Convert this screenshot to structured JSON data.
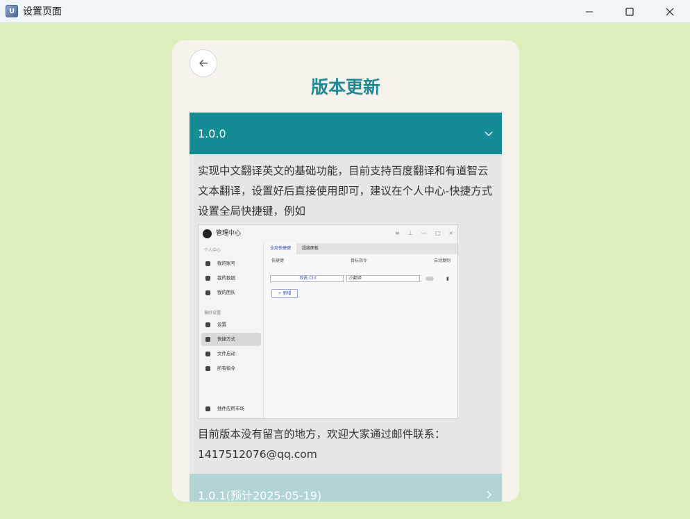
{
  "window": {
    "title": "设置页面",
    "app_icon_glyph": "U"
  },
  "page": {
    "title": "版本更新",
    "accent_color": "#138c96"
  },
  "accordion": [
    {
      "label": "1.0.0",
      "expanded": true,
      "body_text_1": "实现中文翻译英文的基础功能，目前支持百度翻译和有道智云文本翻译，设置好后直接使用即可，建议在个人中心-快捷方式设置全局快捷键，例如",
      "body_text_2": "目前版本没有留言的地方，欢迎大家通过邮件联系：1417512076@qq.com"
    },
    {
      "label": "1.0.1(预计2025-05-19)",
      "expanded": false
    }
  ],
  "screenshot": {
    "title": "管理中心",
    "sidebar": {
      "section1": "个人中心",
      "items1": [
        "我的账号",
        "我的数据",
        "我的团队"
      ],
      "section2": "偏好设置",
      "items2": [
        "设置",
        "快捷方式",
        "文件启动",
        "所有指令"
      ],
      "footer": "插件应用市场"
    },
    "tabs": [
      "全局快捷键",
      "超级面板"
    ],
    "columns": [
      "快捷键",
      "目标指令",
      "自动复制"
    ],
    "row": {
      "key": "双击 Ctrl",
      "target": "小翻译"
    },
    "add_label": "+ 新增"
  }
}
